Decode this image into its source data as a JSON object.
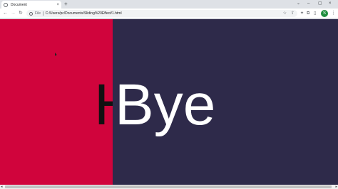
{
  "browser": {
    "tab": {
      "title": "Document",
      "close": "×"
    },
    "new_tab": "+",
    "window_controls": {
      "dropdown": "⌄",
      "minimize": "–",
      "maximize": "▢",
      "close": "×"
    },
    "nav": {
      "back": "←",
      "forward": "→",
      "reload": "↻"
    },
    "address": {
      "scheme": "File",
      "url": "C:/Users/pc/Documents/Sliding%20Effect/1.html"
    },
    "avatar_letter": "S"
  },
  "page": {
    "left_word": "H",
    "right_word": "Bye",
    "colors": {
      "left_panel": "#d0043c",
      "right_panel": "#2e2a4a",
      "left_text": "#111111",
      "right_text": "#ffffff"
    }
  }
}
